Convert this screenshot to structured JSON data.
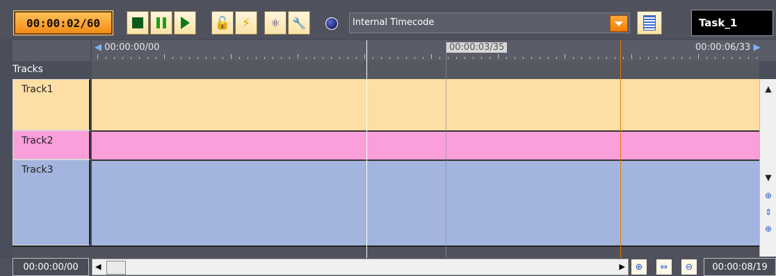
{
  "toolbar": {
    "timecode": "00:00:02/60",
    "timecode_source": "Internal Timecode",
    "task_name": "Task_1",
    "icons": [
      "stop-icon",
      "pause-icon",
      "play-icon",
      "lock-icon",
      "lightning-icon",
      "film-reels-icon",
      "wrench-icon",
      "sync-dot-icon",
      "list-icon"
    ]
  },
  "ruler": {
    "start": "00:00:00/00",
    "middle": "00:00:03/35",
    "end": "00:00:06/33"
  },
  "tracks_header": "Tracks",
  "tracks": [
    {
      "label": "Track1",
      "color": "#fddea4"
    },
    {
      "label": "Track2",
      "color": "#fb9fdb"
    },
    {
      "label": "Track3",
      "color": "#a3b5de"
    }
  ],
  "footer": {
    "range_start": "00:00:00/00",
    "range_end": "00:00:08/19"
  },
  "colors": {
    "accent": "#f28b14",
    "cursor_line": "#e07b00"
  }
}
